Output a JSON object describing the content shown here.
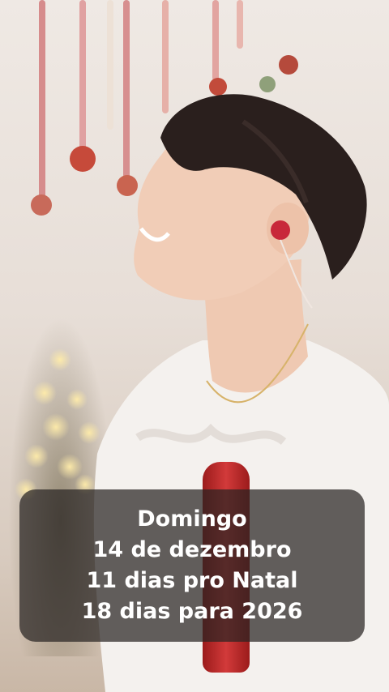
{
  "caption": {
    "line1": "Domingo",
    "line2": "14 de dezembro",
    "line3": "11 dias pro Natal",
    "line4": "18 dias para 2026"
  },
  "colors": {
    "overlay": "#28242299",
    "text": "#ffffff",
    "microphone": "#c62f2f"
  }
}
